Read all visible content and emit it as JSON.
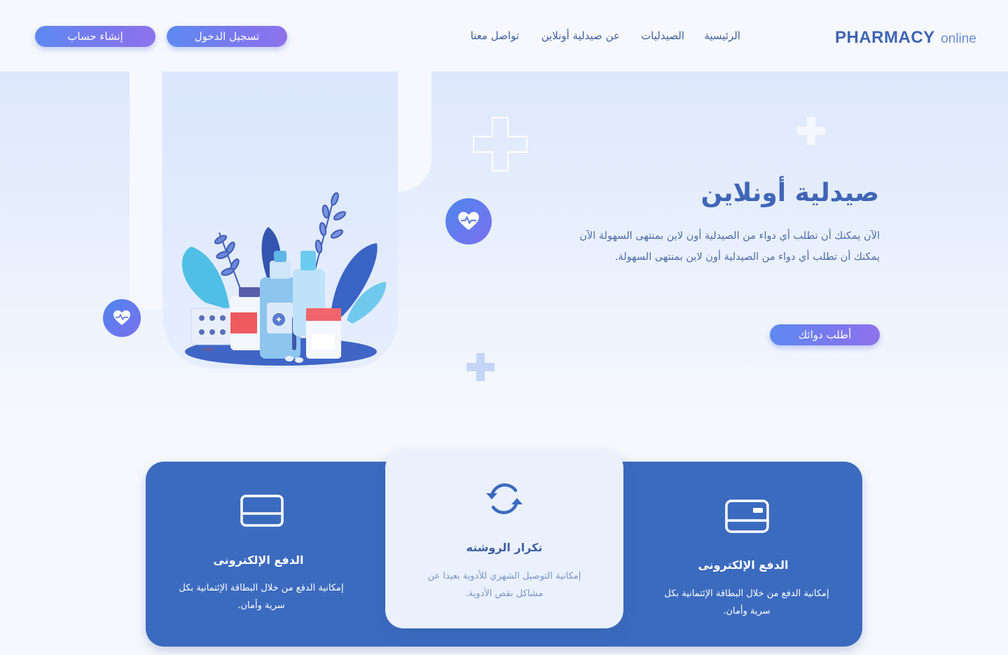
{
  "header": {
    "logo_main": "PHARMACY",
    "logo_sub": "online",
    "nav": [
      "الرئيسية",
      "الصيدليات",
      "عن صيدلية أونلاين",
      "تواصل معنا"
    ],
    "login_label": "تسجيل الدخول",
    "signup_label": "إنشاء حساب"
  },
  "hero": {
    "title": "صيدلية أونلاين",
    "description": "الآن يمكنك أن تطلب أي دواء من الصيدلية أون لاين بمنتهى السهولة الآن يمكنك أن تطلب أي دواء من الصيدلية أون لاين بمنتهى السهولة.",
    "cta_label": "أطلب دوائك",
    "illustration": "medicine-bottles-illustration"
  },
  "features": [
    {
      "icon": "credit-card-icon",
      "title": "الدفع الإلكترونى",
      "text": "إمكانية الدفع من خلال البطاقة الإئتمانية بكل سرية وأمان."
    },
    {
      "icon": "refresh-icon",
      "title": "تكرار الروشته",
      "text": "إمكانية التوصيل الشهري للأدوية بعيدا عن مشاكل نقص الأدوية."
    },
    {
      "icon": "card-icon",
      "title": "الدفع الإلكترونى",
      "text": "إمكانية الدفع من خلال البطاقة الإئتمانية بكل سرية وأمان."
    }
  ],
  "colors": {
    "brand": "#3e64b3",
    "card_blue": "#3b6bbf",
    "button_gradient_start": "#5e8af0",
    "button_gradient_end": "#8e72ec"
  }
}
